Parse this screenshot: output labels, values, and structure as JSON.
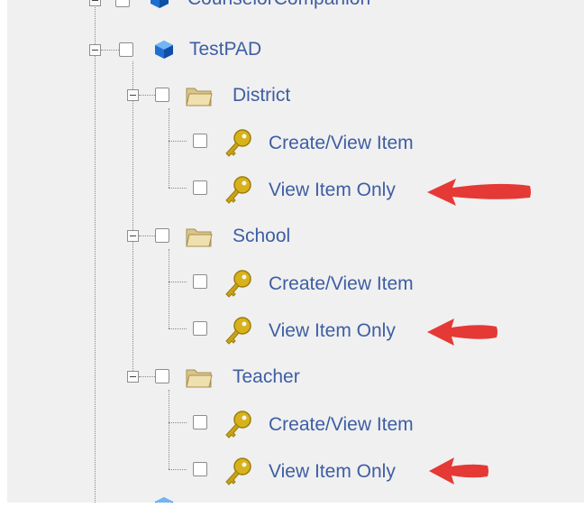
{
  "tree": {
    "partial_top_node": {
      "label": "CounselorCompanion"
    },
    "root": {
      "label": "TestPAD",
      "icon": "cube-icon",
      "children": [
        {
          "label": "District",
          "icon": "folder-icon",
          "children": [
            {
              "label": "Create/View Item",
              "icon": "key-icon"
            },
            {
              "label": "View Item Only",
              "icon": "key-icon"
            }
          ]
        },
        {
          "label": "School",
          "icon": "folder-icon",
          "children": [
            {
              "label": "Create/View Item",
              "icon": "key-icon"
            },
            {
              "label": "View Item Only",
              "icon": "key-icon"
            }
          ]
        },
        {
          "label": "Teacher",
          "icon": "folder-icon",
          "children": [
            {
              "label": "Create/View Item",
              "icon": "key-icon"
            },
            {
              "label": "View Item Only",
              "icon": "key-icon"
            }
          ]
        }
      ]
    }
  },
  "annotation": {
    "icon": "red-arrow-icon",
    "color": "#e53935"
  },
  "colors": {
    "label": "#3d5ea3",
    "background": "#f0f0f0"
  }
}
